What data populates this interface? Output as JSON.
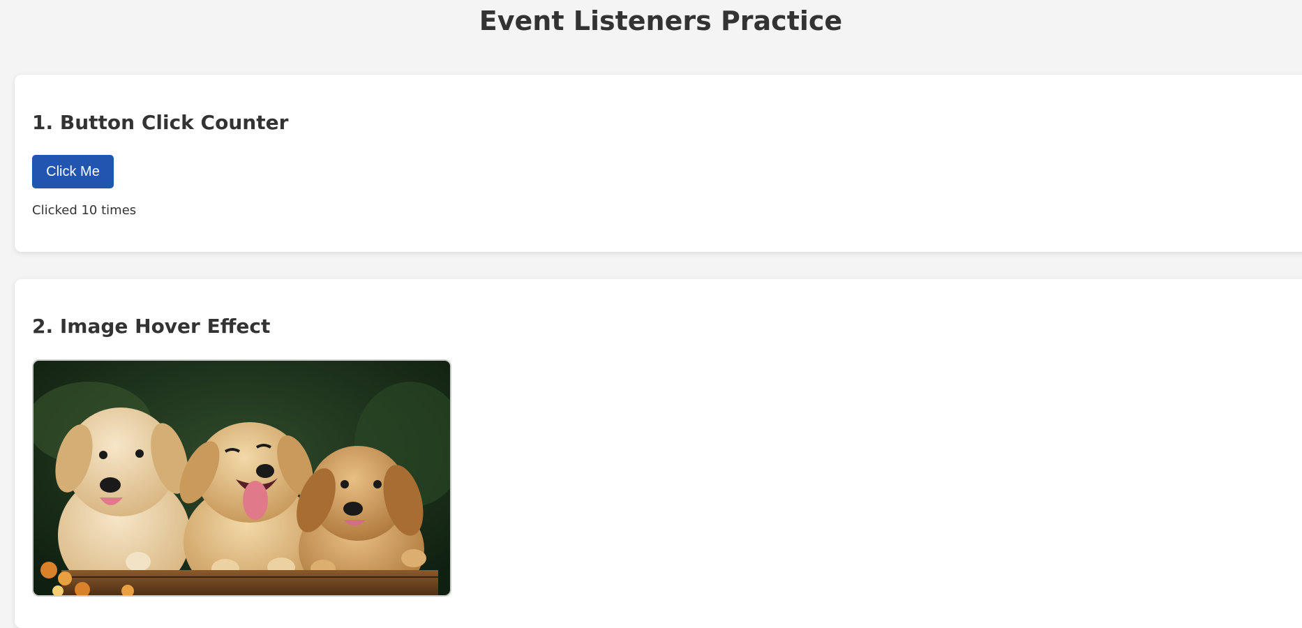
{
  "page": {
    "title": "Event Listeners Practice"
  },
  "section_click": {
    "heading": "1. Button Click Counter",
    "button_label": "Click Me",
    "count_text": "Clicked 10 times"
  },
  "section_hover": {
    "heading": "2. Image Hover Effect",
    "image_alt": "Three golden retriever puppies"
  },
  "colors": {
    "background": "#f4f4f4",
    "card": "#ffffff",
    "button": "#2255b0",
    "text": "#333333"
  }
}
